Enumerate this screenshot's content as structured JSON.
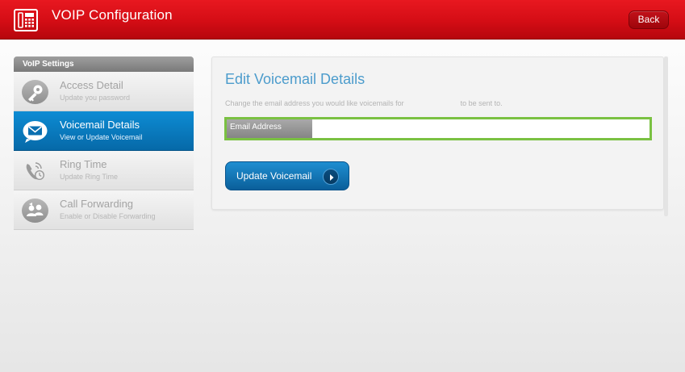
{
  "header": {
    "title": "VOIP Configuration",
    "back_label": "Back",
    "icon": "phone-icon"
  },
  "sidebar": {
    "heading": "VoIP Settings",
    "items": [
      {
        "label": "Access Detail",
        "sub": "Update you password",
        "icon": "key-icon",
        "active": false
      },
      {
        "label": "Voicemail Details",
        "sub": "View or Update Voicemail",
        "icon": "envelope-icon",
        "active": true
      },
      {
        "label": "Ring Time",
        "sub": "Update Ring Time",
        "icon": "ringing-phone-icon",
        "active": false
      },
      {
        "label": "Call Forwarding",
        "sub": "Enable or Disable Forwarding",
        "icon": "forwarding-users-icon",
        "active": false
      }
    ]
  },
  "main": {
    "title": "Edit Voicemail Details",
    "instruction_before": "Change the email address you would like voicemails for",
    "instruction_after": "to be sent to.",
    "email_label": "Email Address",
    "email_value": "",
    "email_placeholder": "",
    "update_label": "Update Voicemail",
    "update_icon": "chevron-right-icon"
  },
  "colors": {
    "header_red": "#d40d15",
    "active_blue": "#0a7cc1",
    "title_blue": "#4c9ccc",
    "focus_green": "#7ac142"
  }
}
